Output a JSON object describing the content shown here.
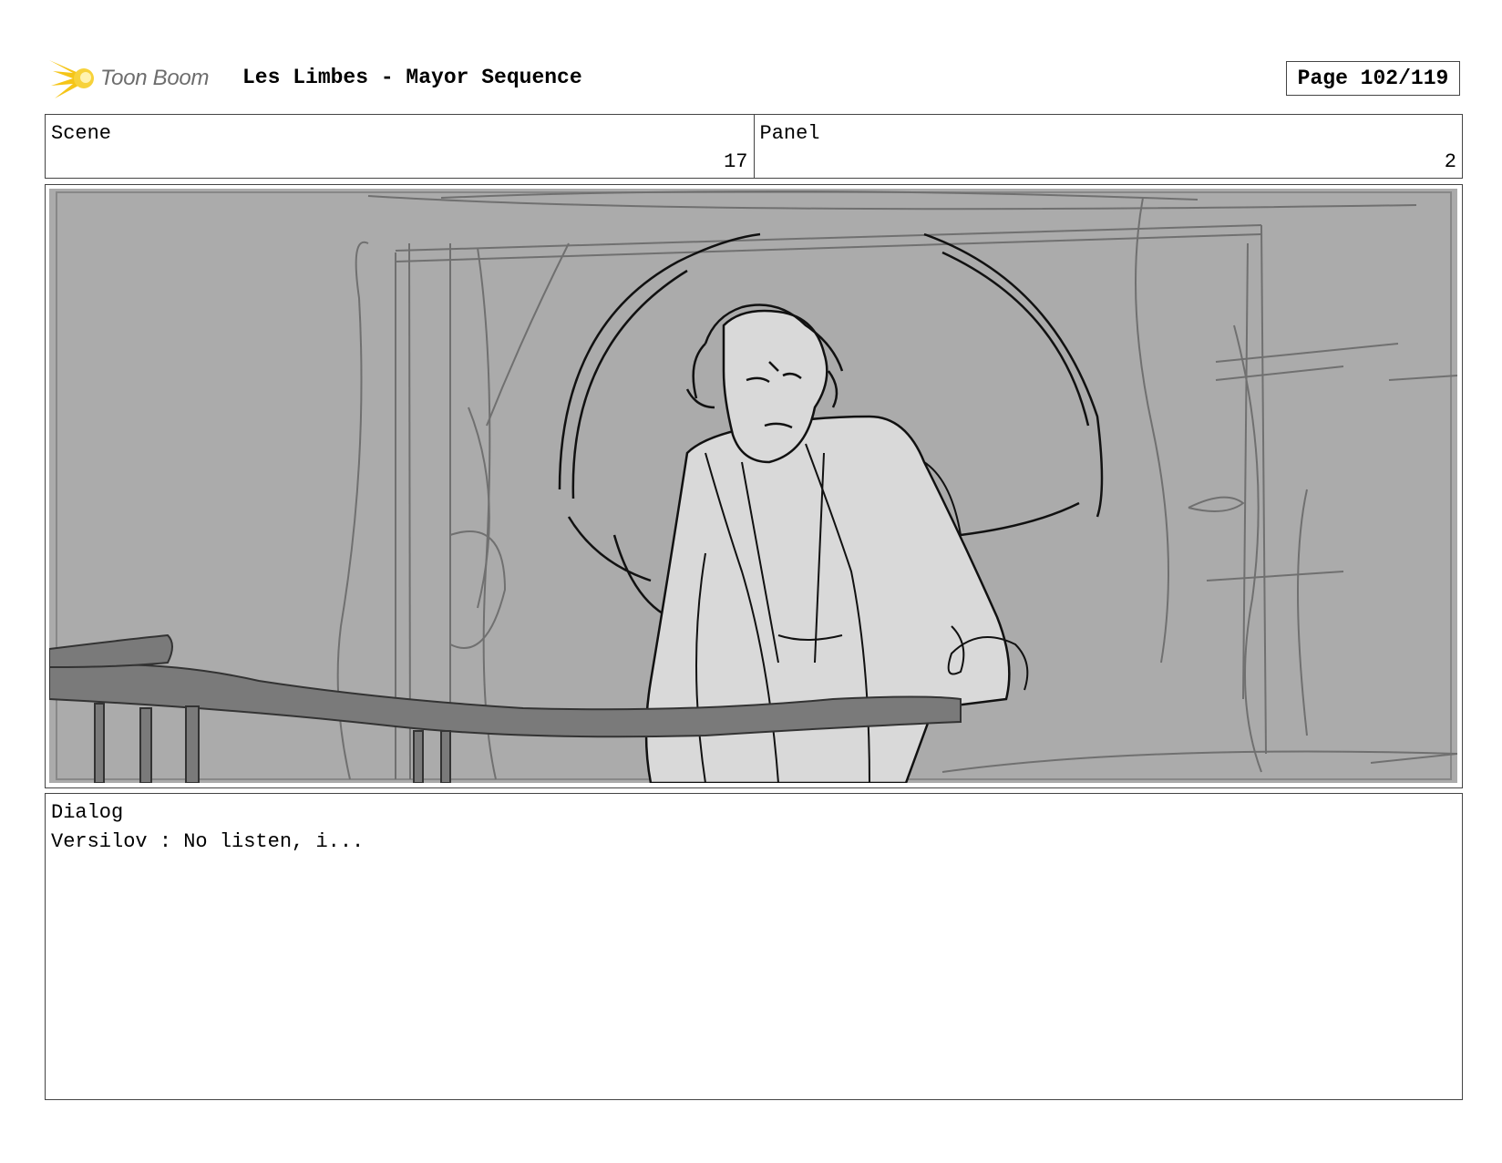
{
  "header": {
    "logo_text": "Toon Boom",
    "title": "Les Limbes - Mayor Sequence",
    "page_label": "Page 102/119"
  },
  "info": {
    "scene_label": "Scene",
    "scene_value": "17",
    "panel_label": "Panel",
    "panel_value": "2"
  },
  "dialog": {
    "label": "Dialog",
    "text": "Versilov : No listen, i..."
  },
  "colors": {
    "logo_star": "#f5c518",
    "logo_text": "#6d6d6d",
    "sketch_background": "#ababab",
    "border": "#444444"
  }
}
